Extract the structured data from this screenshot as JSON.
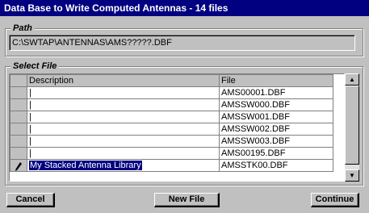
{
  "window": {
    "title": "Data Base to Write Computed Antennas - 14 files"
  },
  "path_group": {
    "label": "Path",
    "value": "C:\\SWTAP\\ANTENNAS\\AMS?????.DBF"
  },
  "select_group": {
    "label": "Select File"
  },
  "grid": {
    "headers": {
      "description": "Description",
      "file": "File"
    },
    "rows": [
      {
        "description": "|",
        "file": "AMS00001.DBF"
      },
      {
        "description": "|",
        "file": "AMSSW000.DBF"
      },
      {
        "description": "|",
        "file": "AMSSW001.DBF"
      },
      {
        "description": "|",
        "file": "AMSSW002.DBF"
      },
      {
        "description": "|",
        "file": "AMSSW003.DBF"
      },
      {
        "description": "|",
        "file": "AMS00195.DBF"
      },
      {
        "description": "My Stacked Antenna Library",
        "file": "AMSSTK00.DBF"
      }
    ],
    "edit_indicator": "pencil-icon"
  },
  "buttons": {
    "cancel": "Cancel",
    "new_file": "New File",
    "continue": "Continue"
  }
}
